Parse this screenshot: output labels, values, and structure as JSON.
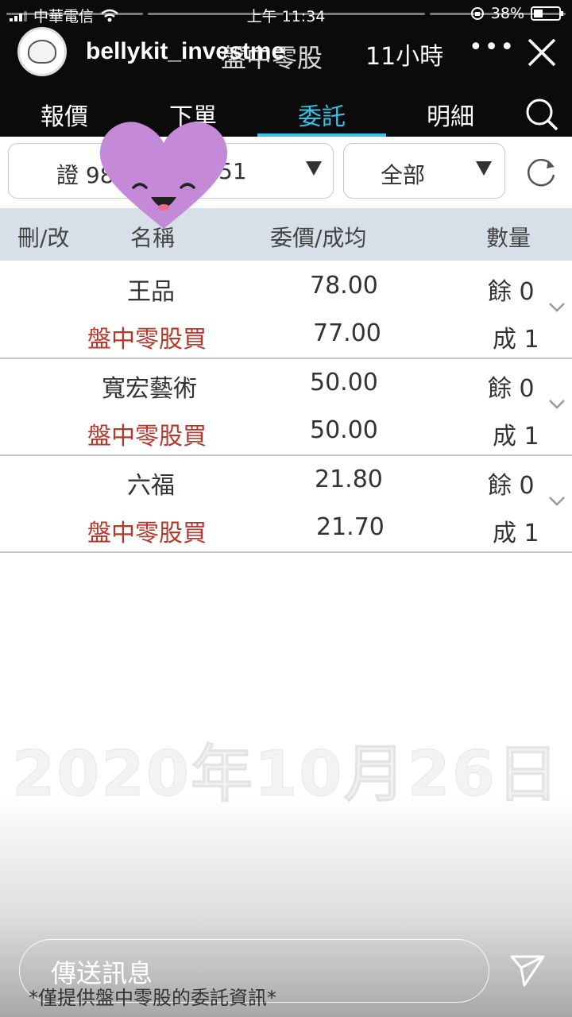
{
  "status_bar": {
    "carrier": "中華電信",
    "time": "上午 11:34",
    "battery": "38%",
    "battery_fraction": 0.38
  },
  "story": {
    "username": "bellykit_investme",
    "time_ago": "11小時",
    "overlay_title": "盤中零股",
    "more_icon": "more-horizontal-icon",
    "close_icon": "close-icon",
    "message_placeholder": "傳送訊息",
    "footnote": "*僅提供盤中零股的委託資訊*",
    "watermark_date": "2020年10月26日",
    "sticker": "smiling-heart-sticker"
  },
  "tabs": [
    {
      "label": "報價",
      "active": false
    },
    {
      "label": "下單",
      "active": false
    },
    {
      "label": "委託",
      "active": true
    },
    {
      "label": "明細",
      "active": false
    }
  ],
  "filters": {
    "account_left": "證 98",
    "account_right": "51",
    "type": "全部"
  },
  "table": {
    "headers": {
      "action": "刪/改",
      "name": "名稱",
      "price": "委價/成均",
      "qty": "數量"
    },
    "rows": [
      {
        "name": "王品",
        "order_type": "盤中零股買",
        "order_price": "78.00",
        "avg_price": "77.00",
        "remaining": "餘 0",
        "filled": "成 1"
      },
      {
        "name": "寬宏藝術",
        "order_type": "盤中零股買",
        "order_price": "50.00",
        "avg_price": "50.00",
        "remaining": "餘 0",
        "filled": "成 1"
      },
      {
        "name": "六福",
        "order_type": "盤中零股買",
        "order_price": "21.80",
        "avg_price": "21.70",
        "remaining": "餘 0",
        "filled": "成 1"
      }
    ]
  },
  "colors": {
    "accent": "#36c2e6",
    "buy_text": "#b8362a",
    "header_bg": "#d7dfe8",
    "sticker": "#c48ad8"
  }
}
